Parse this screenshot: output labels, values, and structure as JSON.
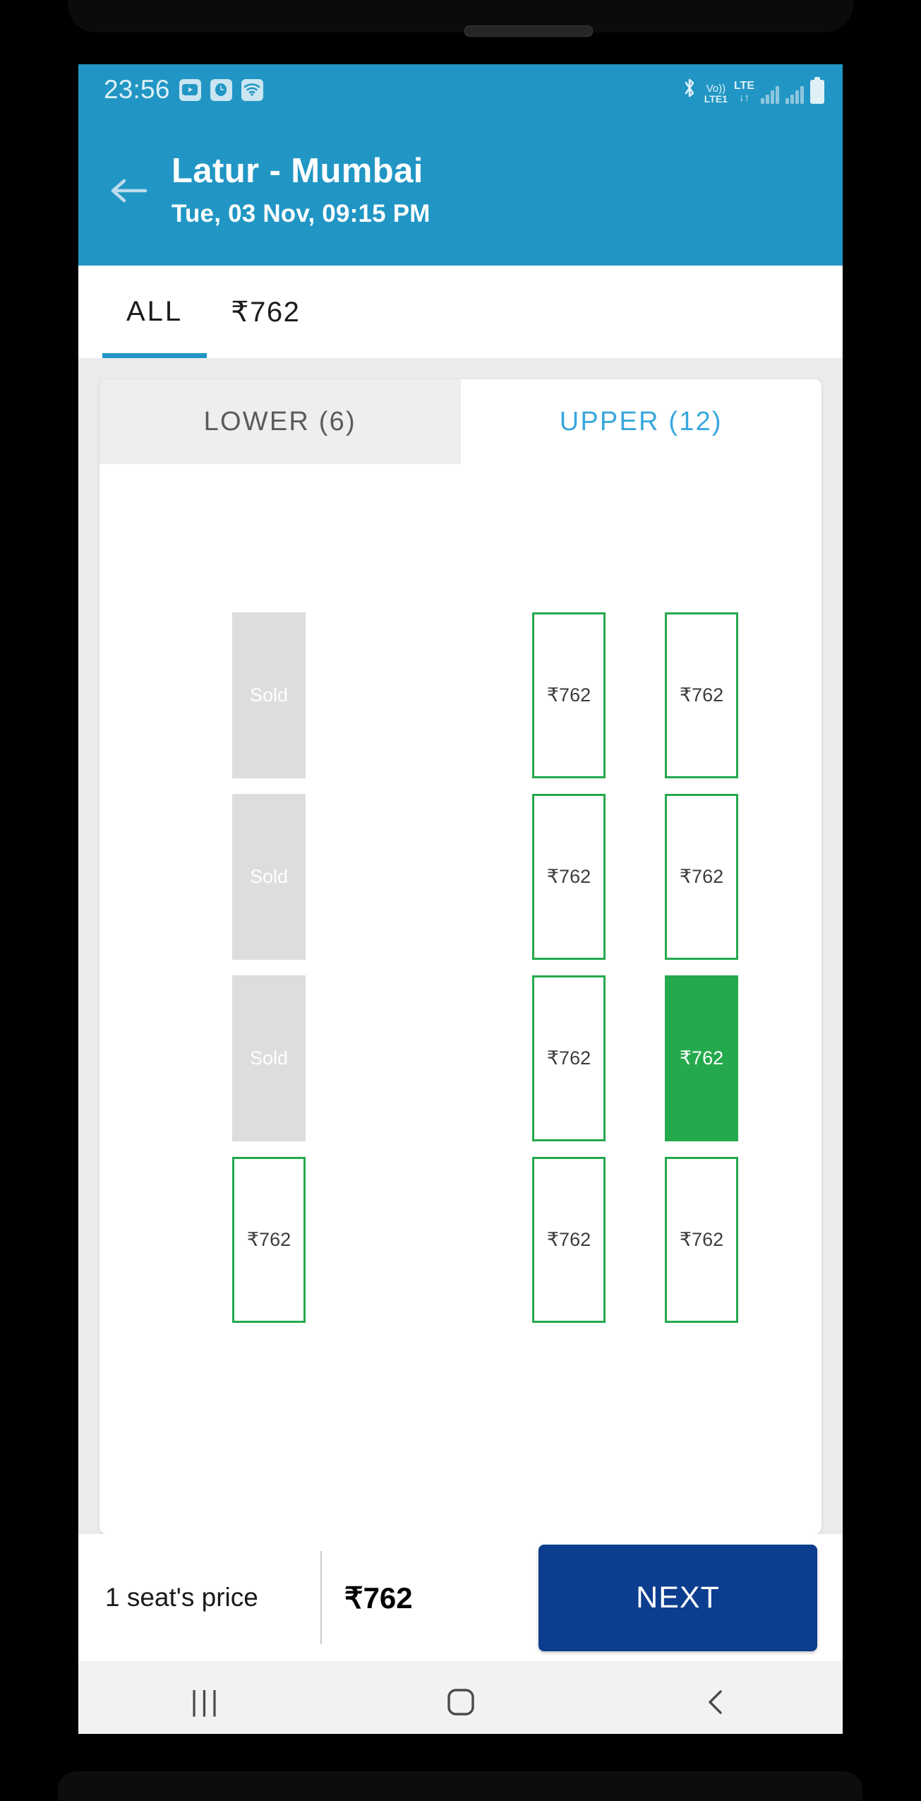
{
  "status_bar": {
    "time": "23:56",
    "left_icons": [
      "youtube-icon",
      "clock-icon",
      "wifi-icon"
    ],
    "right_icons": [
      "bluetooth-icon",
      "volte-icon",
      "lte-icon",
      "signal-bars-icon",
      "battery-icon"
    ],
    "volte_line1": "Vo))",
    "volte_line2": "LTE1",
    "lte_line1": "LTE",
    "lte_line2": "↓↑"
  },
  "app_bar": {
    "back_icon": "back-arrow-icon",
    "title": "Latur - Mumbai",
    "subtitle": "Tue, 03 Nov,  09:15 PM"
  },
  "price_tabs": [
    {
      "label": "ALL",
      "active": true
    },
    {
      "label": "₹762",
      "active": false
    }
  ],
  "deck_tabs": [
    {
      "label": "LOWER (6)",
      "active": false
    },
    {
      "label": "UPPER (12)",
      "active": true
    }
  ],
  "seat_map": {
    "sold_label": "Sold",
    "price_label": "₹762",
    "rows": [
      [
        {
          "state": "sold",
          "label": "Sold"
        },
        {
          "state": "gap",
          "label": ""
        },
        {
          "state": "available",
          "label": "₹762"
        },
        {
          "state": "available",
          "label": "₹762"
        }
      ],
      [
        {
          "state": "sold",
          "label": "Sold"
        },
        {
          "state": "gap",
          "label": ""
        },
        {
          "state": "available",
          "label": "₹762"
        },
        {
          "state": "available",
          "label": "₹762"
        }
      ],
      [
        {
          "state": "sold",
          "label": "Sold"
        },
        {
          "state": "gap",
          "label": ""
        },
        {
          "state": "available",
          "label": "₹762"
        },
        {
          "state": "selected",
          "label": "₹762"
        }
      ],
      [
        {
          "state": "available",
          "label": "₹762"
        },
        {
          "state": "gap",
          "label": ""
        },
        {
          "state": "available",
          "label": "₹762"
        },
        {
          "state": "available",
          "label": "₹762"
        }
      ]
    ]
  },
  "action_bar": {
    "seat_price_label": "1 seat's price",
    "total_price": "₹762",
    "next_label": "NEXT"
  },
  "nav_bar": {
    "recents_glyph": "|||",
    "home_icon": "home-square-icon",
    "back_icon": "nav-back-icon"
  },
  "colors": {
    "brand_blue": "#2196c4",
    "tab_active_blue": "#3aa7dd",
    "seat_green": "#25a94d",
    "sold_gray": "#dddddd",
    "next_navy": "#0c3d8e"
  }
}
